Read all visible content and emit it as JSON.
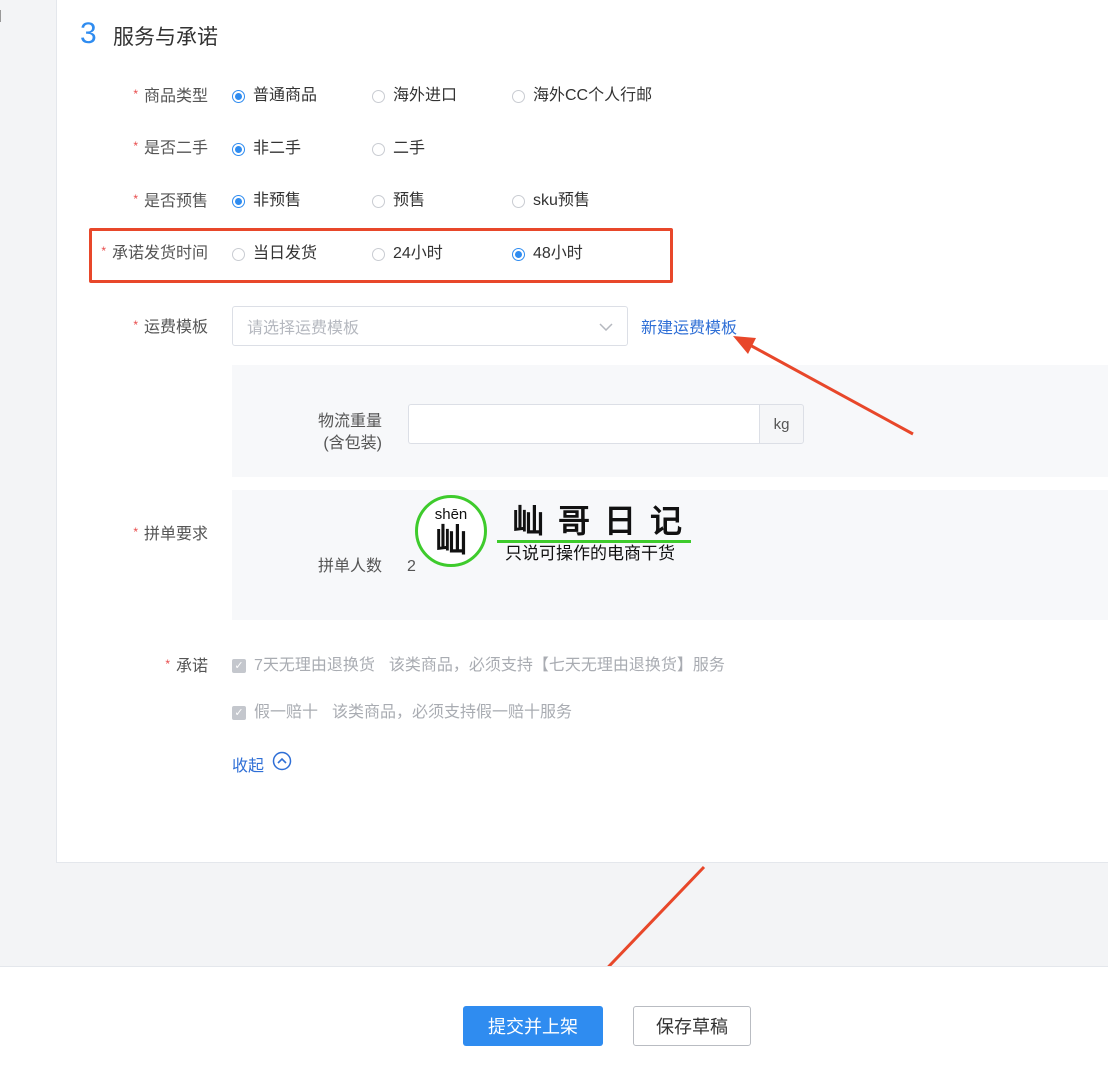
{
  "section": {
    "number": "3",
    "title": "服务与承诺"
  },
  "product_type": {
    "label": "商品类型",
    "options": [
      "普通商品",
      "海外进口",
      "海外CC个人行邮"
    ],
    "selected": 0
  },
  "second_hand": {
    "label": "是否二手",
    "options": [
      "非二手",
      "二手"
    ],
    "selected": 0
  },
  "presale": {
    "label": "是否预售",
    "options": [
      "非预售",
      "预售",
      "sku预售"
    ],
    "selected": 0
  },
  "ship_time": {
    "label": "承诺发货时间",
    "options": [
      "当日发货",
      "24小时",
      "48小时"
    ],
    "selected": 2
  },
  "freight": {
    "label": "运费模板",
    "placeholder": "请选择运费模板",
    "new_link": "新建运费模板"
  },
  "weight": {
    "label_line1": "物流重量",
    "label_line2": "(含包装)",
    "unit": "kg"
  },
  "group_buy": {
    "label": "拼单要求",
    "count_label": "拼单人数",
    "count_value": "2"
  },
  "promise": {
    "label": "承诺",
    "items": [
      {
        "name": "7天无理由退换货",
        "desc": "该类商品，必须支持【七天无理由退换货】服务"
      },
      {
        "name": "假一赔十",
        "desc": "该类商品，必须支持假一赔十服务"
      }
    ],
    "collapse": "收起"
  },
  "watermark": {
    "pinyin": "shēn",
    "char": "屾",
    "title": "屾哥日记",
    "subtitle": "只说可操作的电商干货"
  },
  "footer": {
    "submit": "提交并上架",
    "save_draft": "保存草稿"
  },
  "colors": {
    "primary": "#2f8cf0",
    "highlight": "#e8472a",
    "arrow": "#e8472a",
    "watermark_green": "#3ecb2c"
  }
}
